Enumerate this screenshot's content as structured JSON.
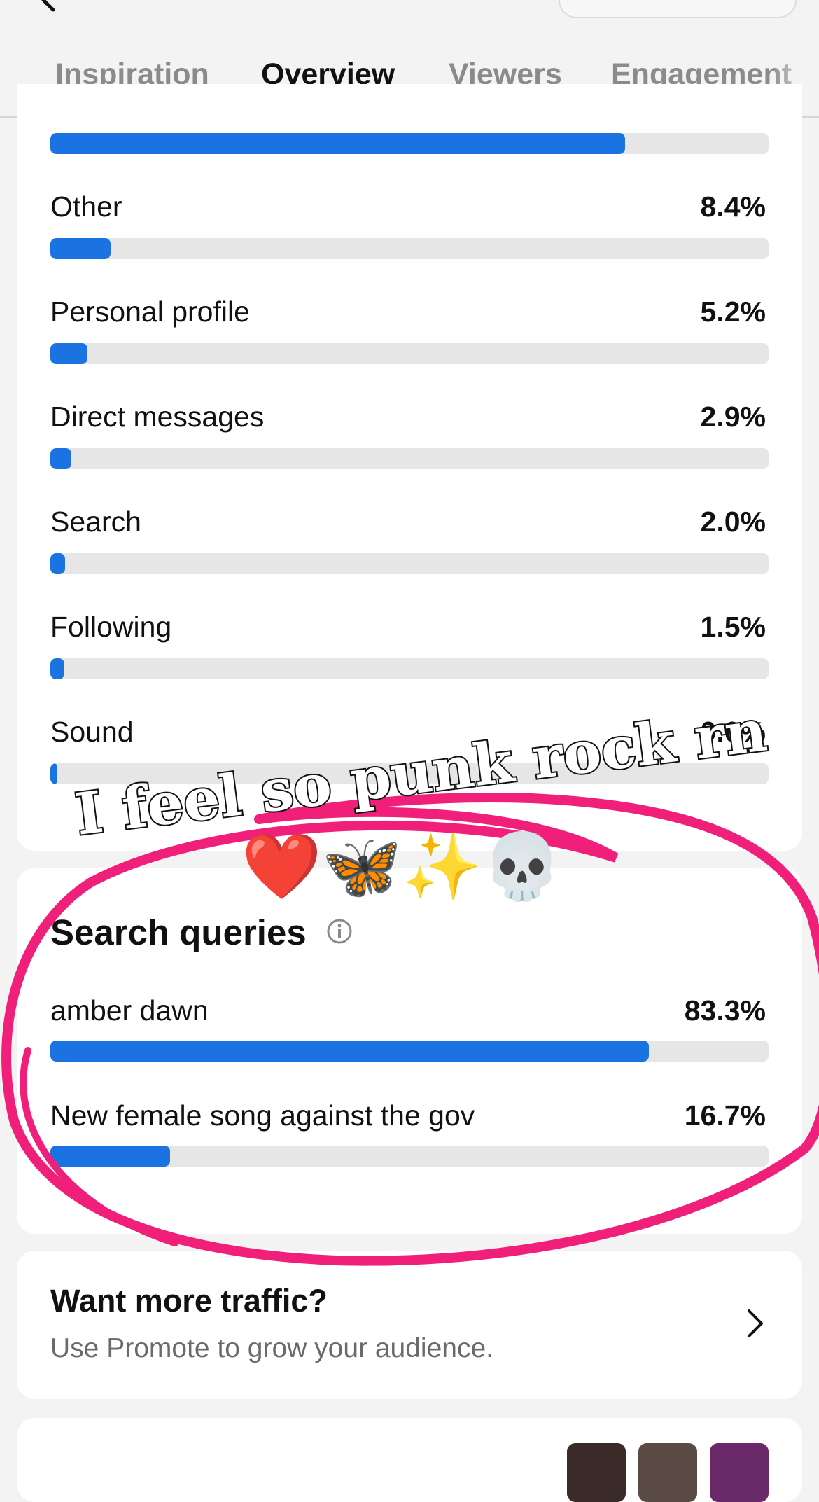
{
  "tabs": [
    "Inspiration",
    "Overview",
    "Viewers",
    "Engagement"
  ],
  "traffic": [
    {
      "label": "Other",
      "value": "8.4%",
      "fraction": 0.084
    },
    {
      "label": "Personal profile",
      "value": "5.2%",
      "fraction": 0.052
    },
    {
      "label": "Direct messages",
      "value": "2.9%",
      "fraction": 0.029
    },
    {
      "label": "Search",
      "value": "2.0%",
      "fraction": 0.02
    },
    {
      "label": "Following",
      "value": "1.5%",
      "fraction": 0.015
    },
    {
      "label": "Sound",
      "value": "0.0%",
      "fraction": 0.0
    }
  ],
  "top_bar_fraction": 0.8,
  "search": {
    "title": "Search queries",
    "items": [
      {
        "label": "amber dawn",
        "value": "83.3%",
        "fraction": 0.833
      },
      {
        "label": "New female song against the gov",
        "value": "16.7%",
        "fraction": 0.167
      }
    ]
  },
  "promo": {
    "title": "Want more traffic?",
    "subtitle": "Use Promote to grow your audience."
  },
  "overlay": {
    "caption": "I feel so punk rock rn",
    "emojis": "❤️🦋✨💀"
  },
  "colors": {
    "accent": "#1a73e0",
    "annotation": "#f0207a"
  }
}
